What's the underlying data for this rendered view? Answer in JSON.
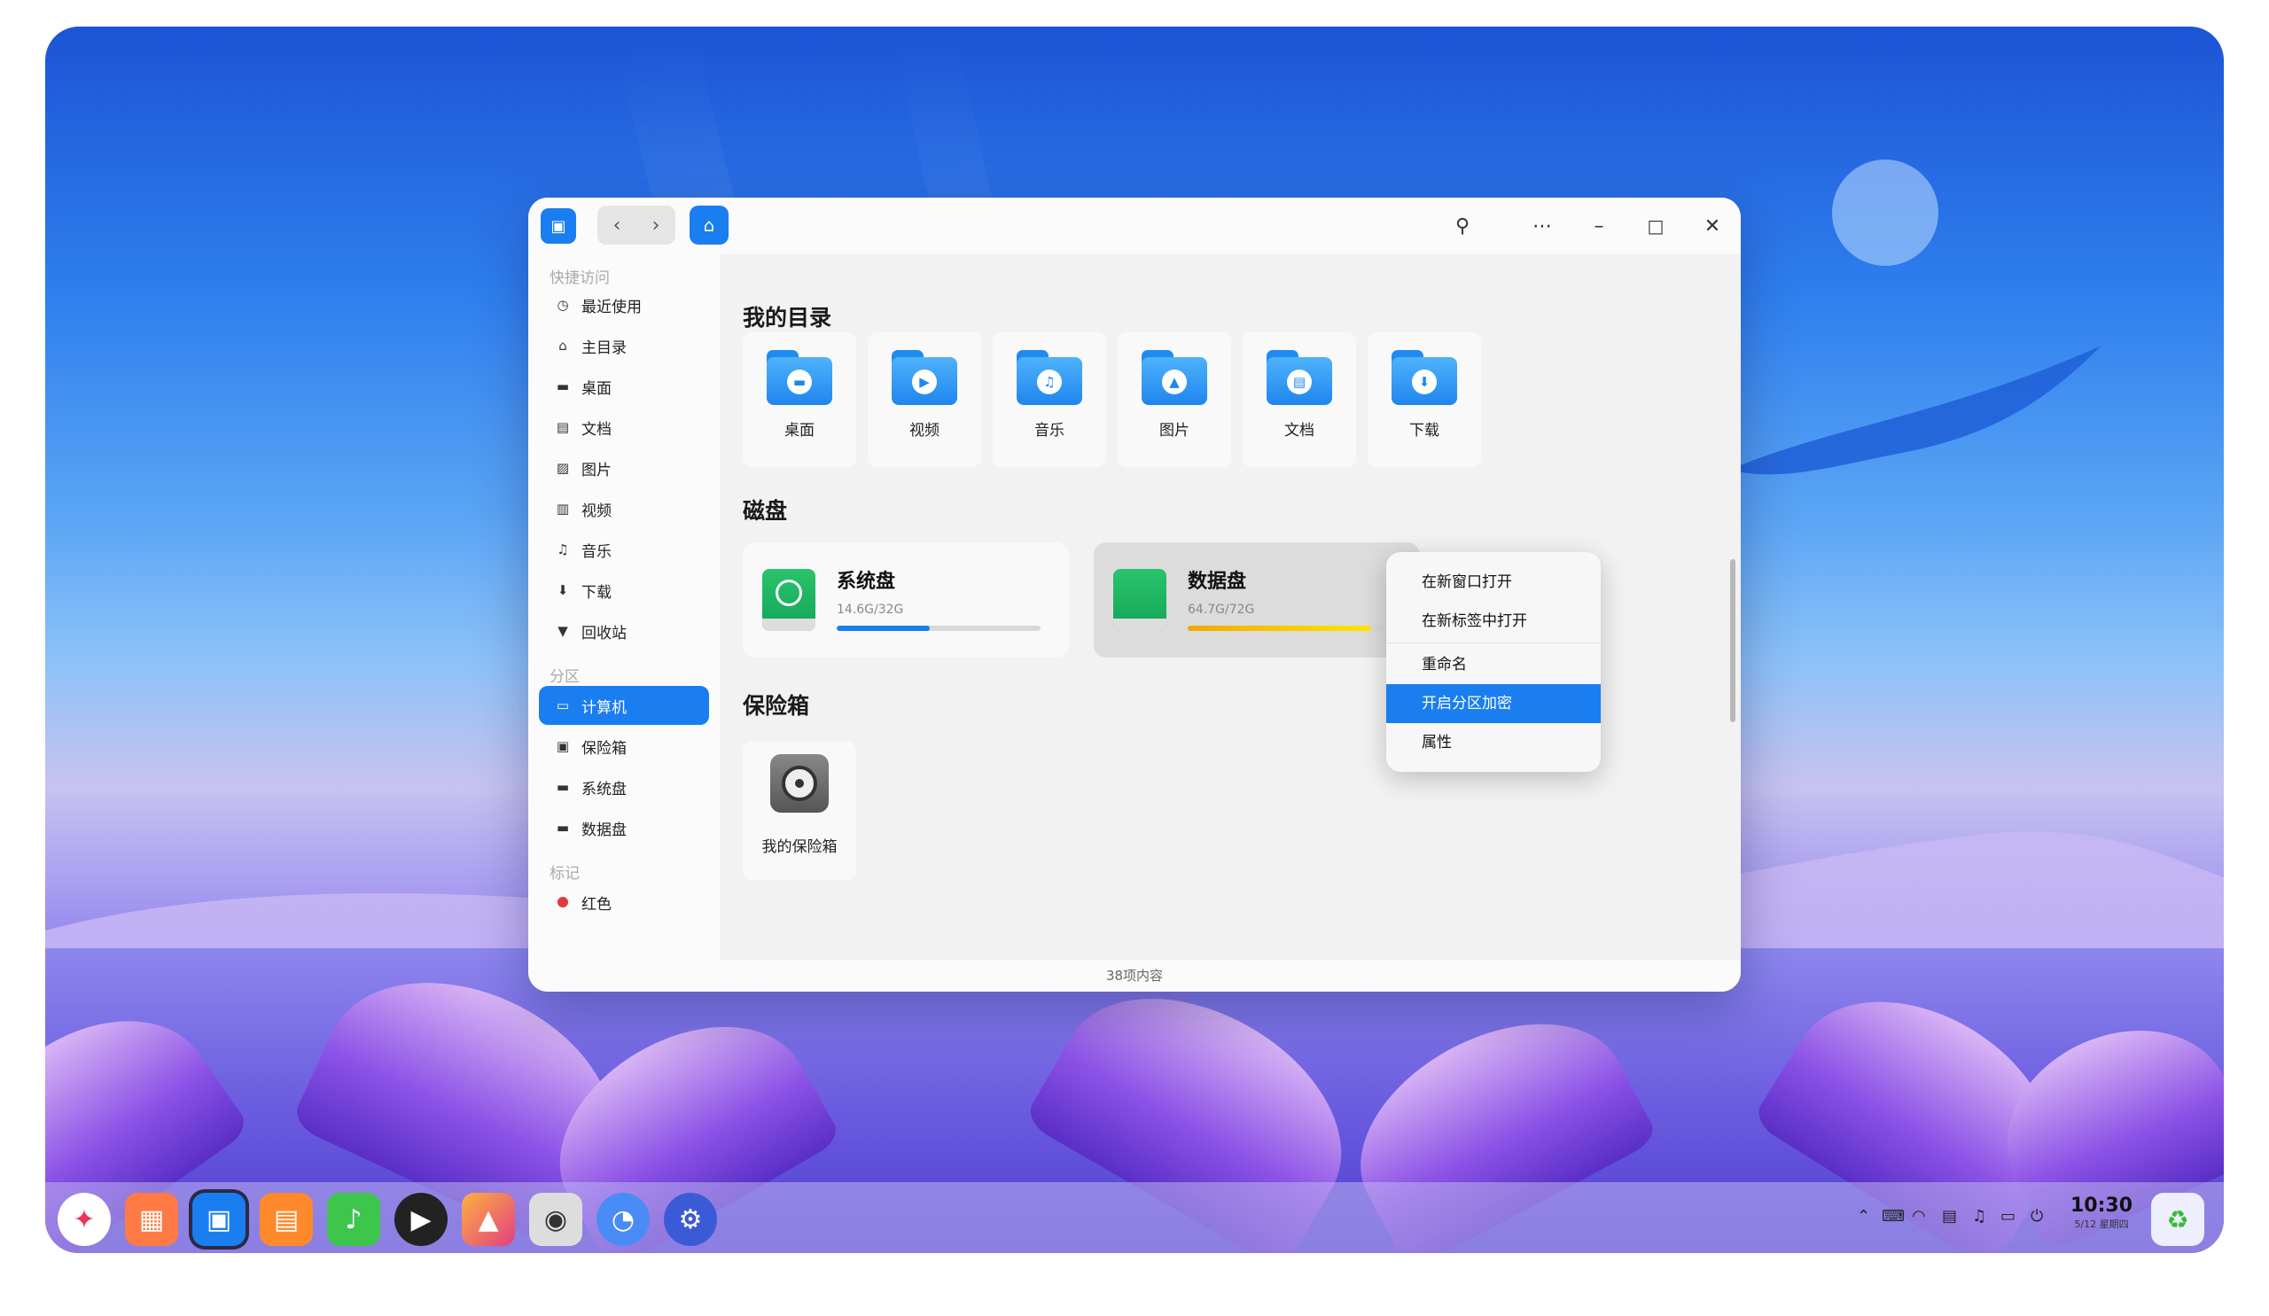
{
  "window": {
    "sidebar": {
      "sections": {
        "quick": "快捷访问",
        "partitions": "分区",
        "tags": "标记"
      },
      "quick_items": [
        {
          "label": "最近使用",
          "icon": "clock-icon"
        },
        {
          "label": "主目录",
          "icon": "home-icon"
        },
        {
          "label": "桌面",
          "icon": "desktop-icon"
        },
        {
          "label": "文档",
          "icon": "document-icon"
        },
        {
          "label": "图片",
          "icon": "image-icon"
        },
        {
          "label": "视频",
          "icon": "video-icon"
        },
        {
          "label": "音乐",
          "icon": "music-icon"
        },
        {
          "label": "下载",
          "icon": "download-icon"
        },
        {
          "label": "回收站",
          "icon": "trash-icon"
        }
      ],
      "partition_items": [
        {
          "label": "计算机",
          "icon": "computer-icon",
          "active": true
        },
        {
          "label": "保险箱",
          "icon": "vault-icon"
        },
        {
          "label": "系统盘",
          "icon": "disk-icon"
        },
        {
          "label": "数据盘",
          "icon": "disk-icon"
        }
      ],
      "tag_items": [
        {
          "label": "红色",
          "color": "#e5383b"
        }
      ]
    },
    "content": {
      "my_dirs_title": "我的目录",
      "dirs": [
        {
          "label": "桌面",
          "icon": "desktop-folder-icon"
        },
        {
          "label": "视频",
          "icon": "video-folder-icon"
        },
        {
          "label": "音乐",
          "icon": "music-folder-icon"
        },
        {
          "label": "图片",
          "icon": "picture-folder-icon"
        },
        {
          "label": "文档",
          "icon": "document-folder-icon"
        },
        {
          "label": "下载",
          "icon": "download-folder-icon"
        }
      ],
      "disks_title": "磁盘",
      "disks": [
        {
          "name": "系统盘",
          "size": "14.6G/32G",
          "usage": 0.456,
          "color": "#1a7ef0"
        },
        {
          "name": "数据盘",
          "size": "64.7G/72G",
          "usage": 0.9,
          "color": "#f0a800"
        }
      ],
      "vault_title": "保险箱",
      "vault_label": "我的保险箱"
    },
    "status": "38项内容"
  },
  "context_menu": {
    "items": [
      "在新窗口打开",
      "在新标签中打开",
      "重命名",
      "开启分区加密",
      "属性"
    ],
    "highlighted": 3
  },
  "taskbar": {
    "apps": [
      "launcher-icon",
      "multitask-icon",
      "file-manager-icon",
      "app-store-icon",
      "music-icon",
      "movie-icon",
      "photos-icon",
      "camera-icon",
      "browser-icon",
      "settings-icon"
    ],
    "clock_time": "10:30",
    "clock_date": "5/12 星期四"
  }
}
